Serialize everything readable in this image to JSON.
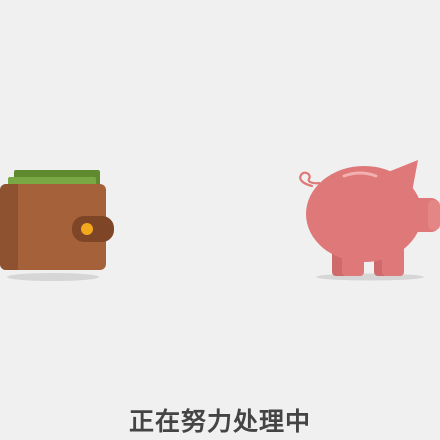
{
  "status": {
    "message": "正在努力处理中"
  },
  "icons": {
    "wallet": "wallet-icon",
    "piggy_bank": "piggy-bank-icon"
  },
  "colors": {
    "background": "#f0f0f0",
    "wallet_body": "#a5623a",
    "wallet_clasp_dot": "#f4a81d",
    "cash": "#6e9a3a",
    "pig_body": "#df7878",
    "text": "#444444"
  }
}
